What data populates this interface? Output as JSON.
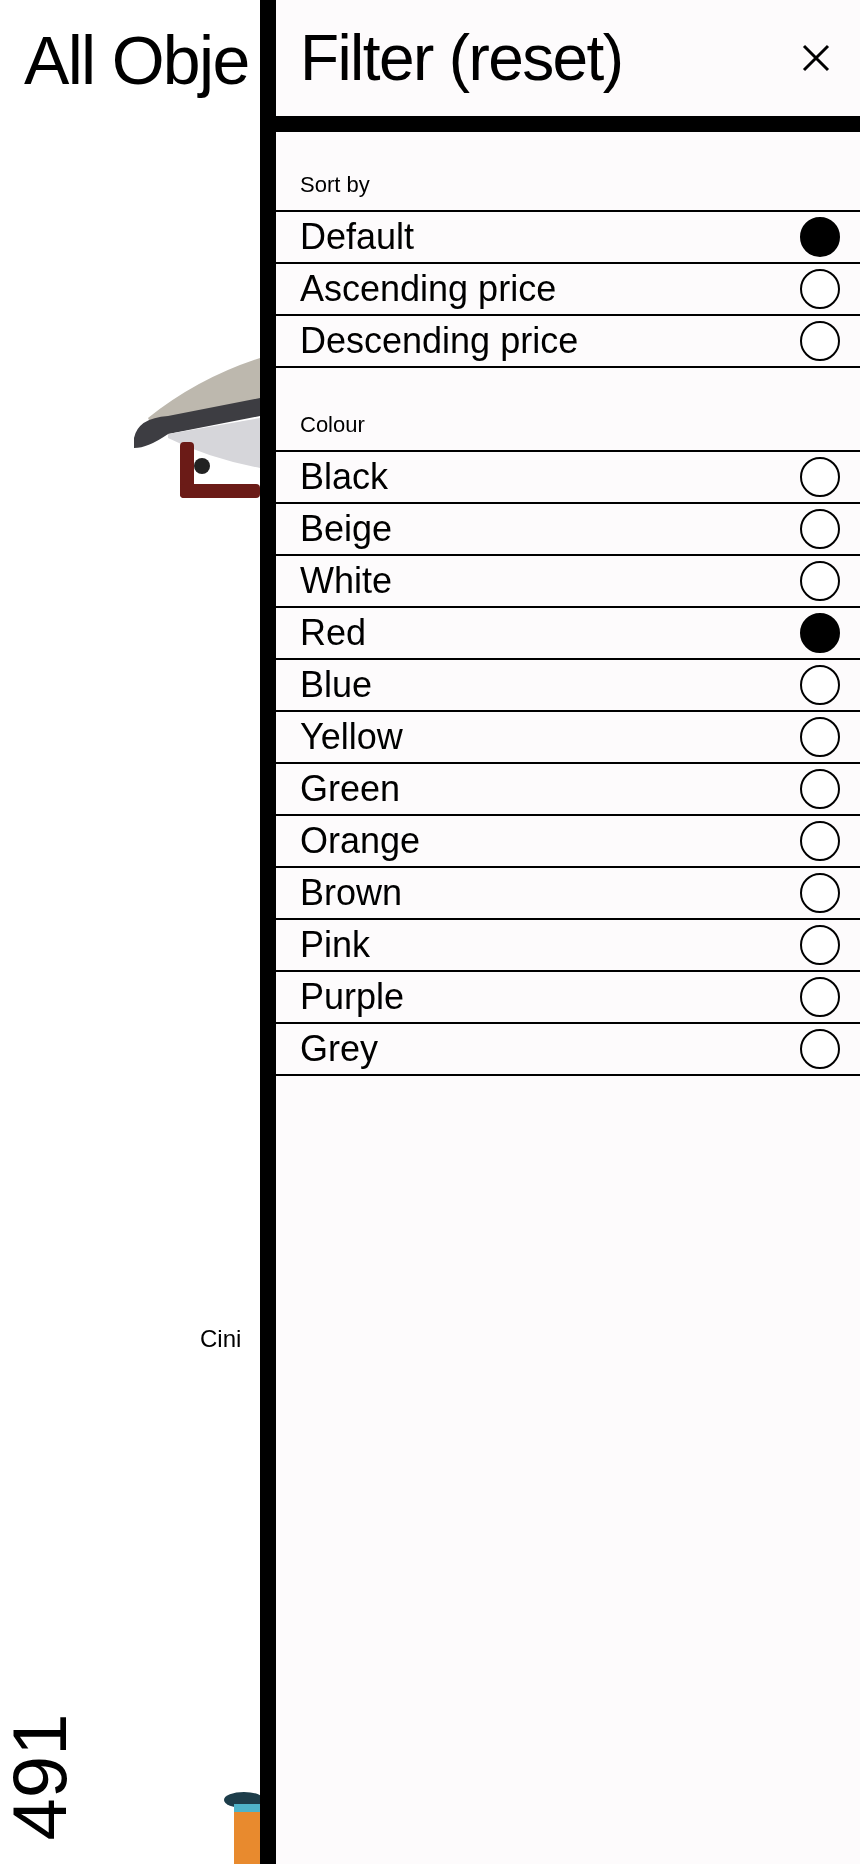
{
  "background": {
    "title": "All Obje",
    "caption": "Cini",
    "count": "491"
  },
  "filter": {
    "title": "Filter (reset)",
    "sections": [
      {
        "label": "Sort by",
        "options": [
          {
            "label": "Default",
            "selected": true
          },
          {
            "label": "Ascending price",
            "selected": false
          },
          {
            "label": "Descending price",
            "selected": false
          }
        ]
      },
      {
        "label": "Colour",
        "options": [
          {
            "label": "Black",
            "selected": false
          },
          {
            "label": "Beige",
            "selected": false
          },
          {
            "label": "White",
            "selected": false
          },
          {
            "label": "Red",
            "selected": true
          },
          {
            "label": "Blue",
            "selected": false
          },
          {
            "label": "Yellow",
            "selected": false
          },
          {
            "label": "Green",
            "selected": false
          },
          {
            "label": "Orange",
            "selected": false
          },
          {
            "label": "Brown",
            "selected": false
          },
          {
            "label": "Pink",
            "selected": false
          },
          {
            "label": "Purple",
            "selected": false
          },
          {
            "label": "Grey",
            "selected": false
          }
        ]
      }
    ]
  }
}
